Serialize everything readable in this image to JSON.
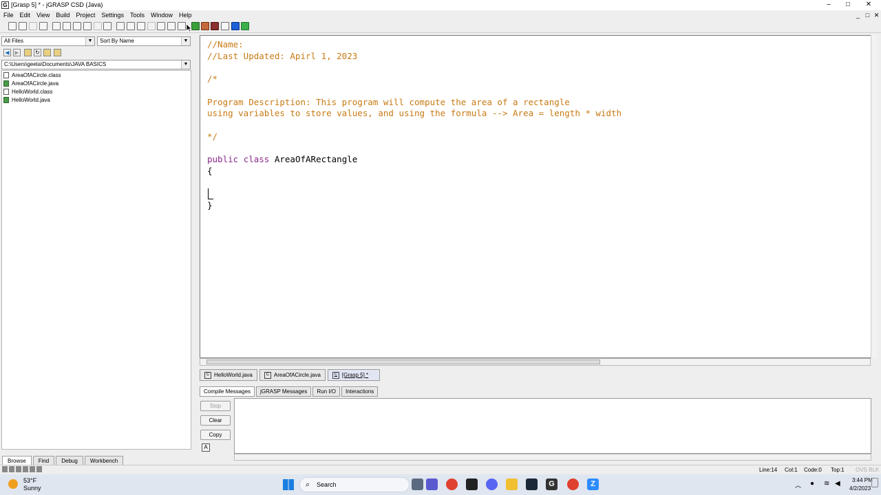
{
  "window": {
    "title": "[Grasp 5] * - jGRASP CSD (Java)",
    "app_icon_letter": "G",
    "minimize": "–",
    "maximize": "□",
    "close": "✕"
  },
  "menu": [
    "File",
    "Edit",
    "View",
    "Build",
    "Project",
    "Settings",
    "Tools",
    "Window",
    "Help"
  ],
  "mdi_controls": [
    "_",
    "□",
    "✕"
  ],
  "browser": {
    "filter": "All Files",
    "sort": "Sort By Name",
    "path": "C:\\Users\\geeta\\Documents\\JAVA BASICS",
    "files": [
      {
        "name": "AreaOfACircle.class",
        "type": "class"
      },
      {
        "name": "AreaOfACircle.java",
        "type": "java"
      },
      {
        "name": "HelloWorld.class",
        "type": "class"
      },
      {
        "name": "HelloWorld.java",
        "type": "java"
      }
    ],
    "tabs": [
      "Browse",
      "Find",
      "Debug",
      "Workbench"
    ]
  },
  "editor": {
    "lines": [
      "//Name:",
      "//Last Updated: Apirl 1, 2023",
      "",
      "/*",
      "",
      "Program Description: This program will compute the area of a rectangle",
      "using variables to store values, and using the formula --> Area = length * width",
      "",
      "*/",
      "",
      "public class AreaOfARectangle",
      "{",
      "",
      "",
      "}"
    ],
    "keyword_public": "public",
    "keyword_class": "class",
    "class_name": "AreaOfARectangle"
  },
  "file_tabs": [
    "HelloWorld.java",
    "AreaOfACircle.java",
    "[Grasp 5] *"
  ],
  "message_tabs": [
    "Compile Messages",
    "jGRASP Messages",
    "Run I/O",
    "Interactions"
  ],
  "message_buttons": {
    "stop": "Stop",
    "clear": "Clear",
    "copy": "Copy"
  },
  "status": {
    "line": "Line:14",
    "col": "Col:1",
    "code": "Code:0",
    "top": "Top:1",
    "mode": "OVS BLK"
  },
  "taskbar": {
    "weather_temp": "53°F",
    "weather_desc": "Sunny",
    "search": "Search",
    "time": "3:44 PM",
    "date": "4/2/2023"
  }
}
